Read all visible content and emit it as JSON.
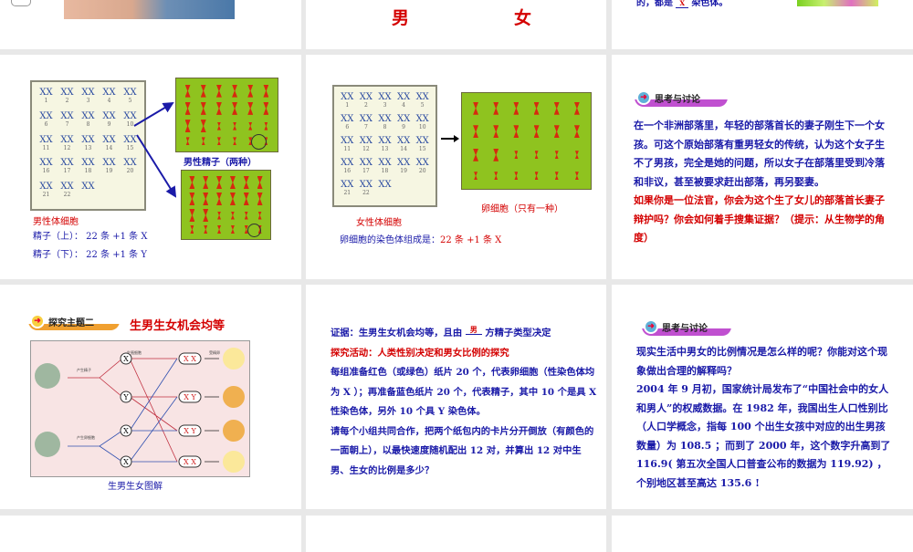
{
  "row0": {
    "male": "男",
    "female": "女",
    "fragment_text_before": "的，都是",
    "fragment_blank": "X",
    "fragment_text_after": "染色体。"
  },
  "slide_male": {
    "karyotype_numbers": [
      "1",
      "2",
      "3",
      "4",
      "5",
      "6",
      "7",
      "8",
      "9",
      "10",
      "11",
      "12",
      "13",
      "14",
      "15",
      "16",
      "17",
      "18",
      "19",
      "20",
      "21",
      "22"
    ],
    "sperm_label": "男性精子（两种）",
    "cell_label": "男性体细胞",
    "sperm_top": "精子（上）： 22 条 +1 条 X",
    "sperm_bottom": "精子（下）：  22 条 +1 条 Y"
  },
  "slide_female": {
    "egg_label": "卵细胞（只有一种）",
    "cell_label": "女性体细胞",
    "composition_prefix": "卵细胞的染色体组成是：",
    "composition_value": "22 条 +1 条 X"
  },
  "slide_discuss1": {
    "badge": "思考与讨论",
    "paragraph": "在一个非洲部落里，年轻的部落首长的妻子刚生下一个女孩。可这个原始部落有重男轻女的传统，认为这个女子生不了男孩，完全是她的问题，所以女子在部落里受到冷落和非议，甚至被要求赶出部落，再另娶妻。",
    "question": "如果你是一位法官，你会为这个生了女儿的部落首长妻子辩护吗？你会如何着手搜集证据？（提示：从生物学的角度）"
  },
  "slide_topic2": {
    "badge": "探究主题二",
    "title": "生男生女机会均等",
    "diagram": {
      "germ_cells": "生殖细胞",
      "zygote": "受精卵",
      "produce_sperm": "产生精子",
      "produce_egg": "产生卵细胞",
      "sperm": [
        "X",
        "Y"
      ],
      "eggs": [
        "X",
        "X"
      ],
      "zygotes": [
        "X X",
        "X Y",
        "X Y",
        "X X"
      ]
    },
    "caption": "生男生女图解"
  },
  "slide_activity": {
    "evidence_prefix": "证据：生男生女机会均等，且由",
    "evidence_blank": "男",
    "evidence_suffix": "方精子类型决定",
    "activity_title": "探究活动：人类性别决定和男女比例的探究",
    "body1": "每组准备红色（或绿色）纸片 20 个，代表卵细胞（性染色体均为 X ）；再准备蓝色纸片 20 个，代表精子，其中 10 个是具 X 性染色体，另外 10 个具 Y 染色体。",
    "body2": "请每个小组共同合作，把两个纸包内的卡片分开倒放（有颜色的一面朝上），以最快速度随机配出 12 对，并算出 12 对中生男、生女的比例是多少？"
  },
  "slide_discuss2": {
    "badge": "思考与讨论",
    "question": "现实生活中男女的比例情况是怎么样的呢？你能对这个现象做出合理的解释吗？",
    "body": "2004 年 9 月初，国家统计局发布了“中国社会中的女人和男人”的权威数据。在 1982 年，我国出生人口性别比（人口学概念，指每 100 个出生女孩中对应的出生男孩数量）为 108.5 ；而到了 2000 年，这个数字升高到了 116.9( 第五次全国人口普查公布的数据为 119.92) ，个别地区甚至高达 135.6 !"
  },
  "colors": {
    "text_blue": "#1a1aa8",
    "text_red": "#d40000",
    "green": "#8fc31f"
  }
}
